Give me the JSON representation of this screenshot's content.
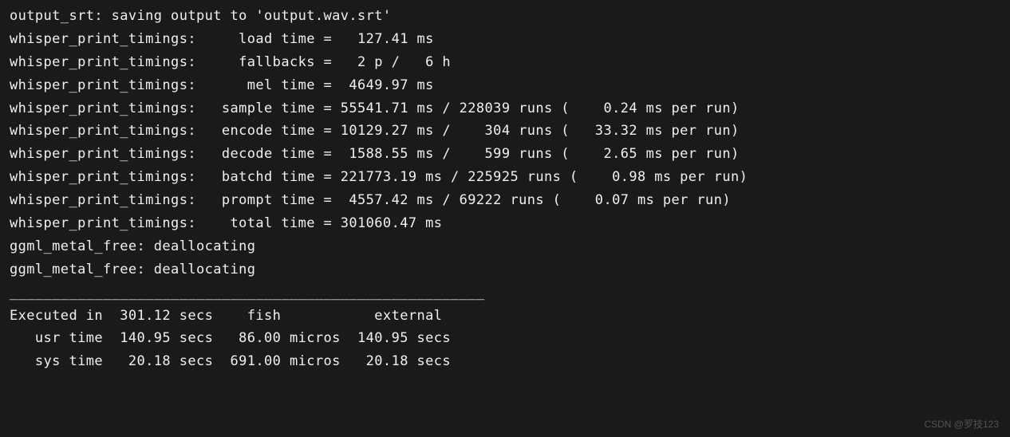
{
  "lines": {
    "output_srt": "output_srt: saving output to 'output.wav.srt'",
    "blank1": "",
    "load": "whisper_print_timings:     load time =   127.41 ms",
    "fallbk": "whisper_print_timings:     fallbacks =   2 p /   6 h",
    "mel": "whisper_print_timings:      mel time =  4649.97 ms",
    "sample": "whisper_print_timings:   sample time = 55541.71 ms / 228039 runs (    0.24 ms per run)",
    "encode": "whisper_print_timings:   encode time = 10129.27 ms /    304 runs (   33.32 ms per run)",
    "decode": "whisper_print_timings:   decode time =  1588.55 ms /    599 runs (    2.65 ms per run)",
    "batchd": "whisper_print_timings:   batchd time = 221773.19 ms / 225925 runs (    0.98 ms per run)",
    "prompt": "whisper_print_timings:   prompt time =  4557.42 ms / 69222 runs (    0.07 ms per run)",
    "total": "whisper_print_timings:    total time = 301060.47 ms",
    "ggml1": "ggml_metal_free: deallocating",
    "ggml2": "ggml_metal_free: deallocating",
    "blank2": "",
    "divider": "________________________________________________________",
    "exec": "Executed in  301.12 secs    fish           external",
    "usr": "   usr time  140.95 secs   86.00 micros  140.95 secs",
    "sys": "   sys time   20.18 secs  691.00 micros   20.18 secs"
  },
  "timings": {
    "load_ms": 127.41,
    "fallbacks_p": 2,
    "fallbacks_h": 6,
    "mel_ms": 4649.97,
    "sample": {
      "ms": 55541.71,
      "runs": 228039,
      "ms_per_run": 0.24
    },
    "encode": {
      "ms": 10129.27,
      "runs": 304,
      "ms_per_run": 33.32
    },
    "decode": {
      "ms": 1588.55,
      "runs": 599,
      "ms_per_run": 2.65
    },
    "batchd": {
      "ms": 221773.19,
      "runs": 225925,
      "ms_per_run": 0.98
    },
    "prompt": {
      "ms": 4557.42,
      "runs": 69222,
      "ms_per_run": 0.07
    },
    "total_ms": 301060.47
  },
  "exec_summary": {
    "executed_in_secs": 301.12,
    "shells": [
      "fish",
      "external"
    ],
    "usr_time": {
      "secs": 140.95,
      "fish": "86.00 micros",
      "external": "140.95 secs"
    },
    "sys_time": {
      "secs": 20.18,
      "fish": "691.00 micros",
      "external": "20.18 secs"
    }
  },
  "watermark": "CSDN @罗技123"
}
